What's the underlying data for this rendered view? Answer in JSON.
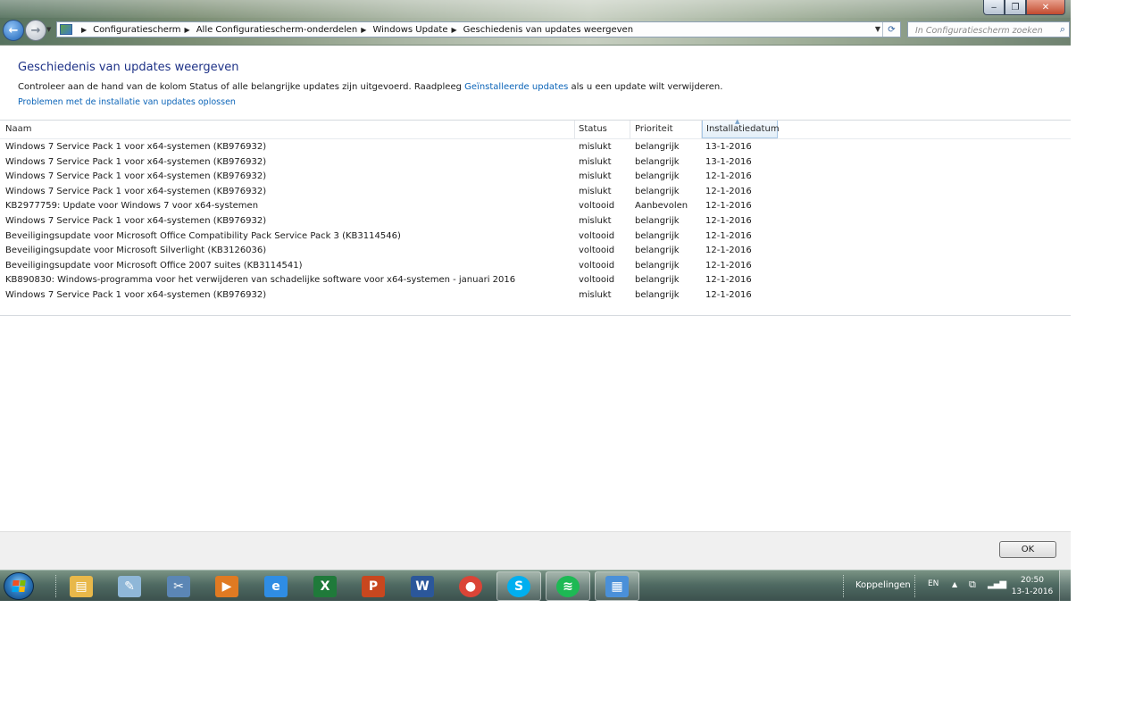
{
  "window": {
    "minimize_glyph": "‒",
    "maximize_glyph": "❐",
    "close_glyph": "✕"
  },
  "navigation": {
    "back_glyph": "←",
    "forward_glyph": "→",
    "breadcrumb": [
      "Configuratiescherm",
      "Alle Configuratiescherm-onderdelen",
      "Windows Update",
      "Geschiedenis van updates weergeven"
    ],
    "search_placeholder": "In Configuratiescherm zoeken"
  },
  "page": {
    "title": "Geschiedenis van updates weergeven",
    "intro_before_link": "Controleer aan de hand van de kolom Status of alle belangrijke updates zijn uitgevoerd. Raadpleeg ",
    "intro_link": "Geïnstalleerde updates",
    "intro_after_link": " als u een update wilt verwijderen.",
    "trouble_link": "Problemen met de installatie van updates oplossen"
  },
  "table": {
    "columns": [
      "Naam",
      "Status",
      "Prioriteit",
      "Installatiedatum"
    ],
    "sorted_column": "Installatiedatum",
    "rows": [
      {
        "name": "Windows 7 Service Pack 1 voor x64-systemen (KB976932)",
        "status": "mislukt",
        "priority": "belangrijk",
        "date": "13-1-2016"
      },
      {
        "name": "Windows 7 Service Pack 1 voor x64-systemen (KB976932)",
        "status": "mislukt",
        "priority": "belangrijk",
        "date": "13-1-2016"
      },
      {
        "name": "Windows 7 Service Pack 1 voor x64-systemen (KB976932)",
        "status": "mislukt",
        "priority": "belangrijk",
        "date": "12-1-2016"
      },
      {
        "name": "Windows 7 Service Pack 1 voor x64-systemen (KB976932)",
        "status": "mislukt",
        "priority": "belangrijk",
        "date": "12-1-2016"
      },
      {
        "name": "KB2977759: Update voor Windows 7 voor x64-systemen",
        "status": "voltooid",
        "priority": "Aanbevolen",
        "date": "12-1-2016"
      },
      {
        "name": "Windows 7 Service Pack 1 voor x64-systemen (KB976932)",
        "status": "mislukt",
        "priority": "belangrijk",
        "date": "12-1-2016"
      },
      {
        "name": "Beveiligingsupdate voor Microsoft Office Compatibility Pack Service Pack 3 (KB3114546)",
        "status": "voltooid",
        "priority": "belangrijk",
        "date": "12-1-2016"
      },
      {
        "name": "Beveiligingsupdate voor Microsoft Silverlight (KB3126036)",
        "status": "voltooid",
        "priority": "belangrijk",
        "date": "12-1-2016"
      },
      {
        "name": "Beveiligingsupdate voor Microsoft Office 2007 suites (KB3114541)",
        "status": "voltooid",
        "priority": "belangrijk",
        "date": "12-1-2016"
      },
      {
        "name": "KB890830: Windows-programma voor het verwijderen van schadelijke software voor x64-systemen - januari 2016",
        "status": "voltooid",
        "priority": "belangrijk",
        "date": "12-1-2016"
      },
      {
        "name": "Windows 7 Service Pack 1 voor x64-systemen (KB976932)",
        "status": "mislukt",
        "priority": "belangrijk",
        "date": "12-1-2016"
      }
    ]
  },
  "footer": {
    "ok_label": "OK"
  },
  "taskbar": {
    "pinned": [
      {
        "icon": "file-explorer-icon",
        "glyph": "▤",
        "color": "#e8b84a"
      },
      {
        "icon": "notepad-icon",
        "glyph": "✎",
        "color": "#8fb7d8"
      },
      {
        "icon": "tools-icon",
        "glyph": "✂",
        "color": "#5b86b5"
      },
      {
        "icon": "media-player-icon",
        "glyph": "▶",
        "color": "#e07a22"
      },
      {
        "icon": "internet-explorer-icon",
        "glyph": "e",
        "color": "#2f8de4"
      },
      {
        "icon": "excel-icon",
        "glyph": "X",
        "color": "#1f7a3a"
      },
      {
        "icon": "powerpoint-icon",
        "glyph": "P",
        "color": "#c8471f"
      },
      {
        "icon": "word-icon",
        "glyph": "W",
        "color": "#2b579a"
      },
      {
        "icon": "chrome-icon",
        "glyph": "●",
        "color": "#db4437"
      },
      {
        "icon": "skype-icon",
        "glyph": "S",
        "color": "#00aff0"
      },
      {
        "icon": "spotify-icon",
        "glyph": "≋",
        "color": "#1db954"
      },
      {
        "icon": "control-panel-icon",
        "glyph": "▦",
        "color": "#4a90d9"
      }
    ],
    "links_label": "Koppelingen",
    "language": "EN",
    "tray_up_glyph": "▲",
    "time": "20:50",
    "date": "13-1-2016"
  }
}
